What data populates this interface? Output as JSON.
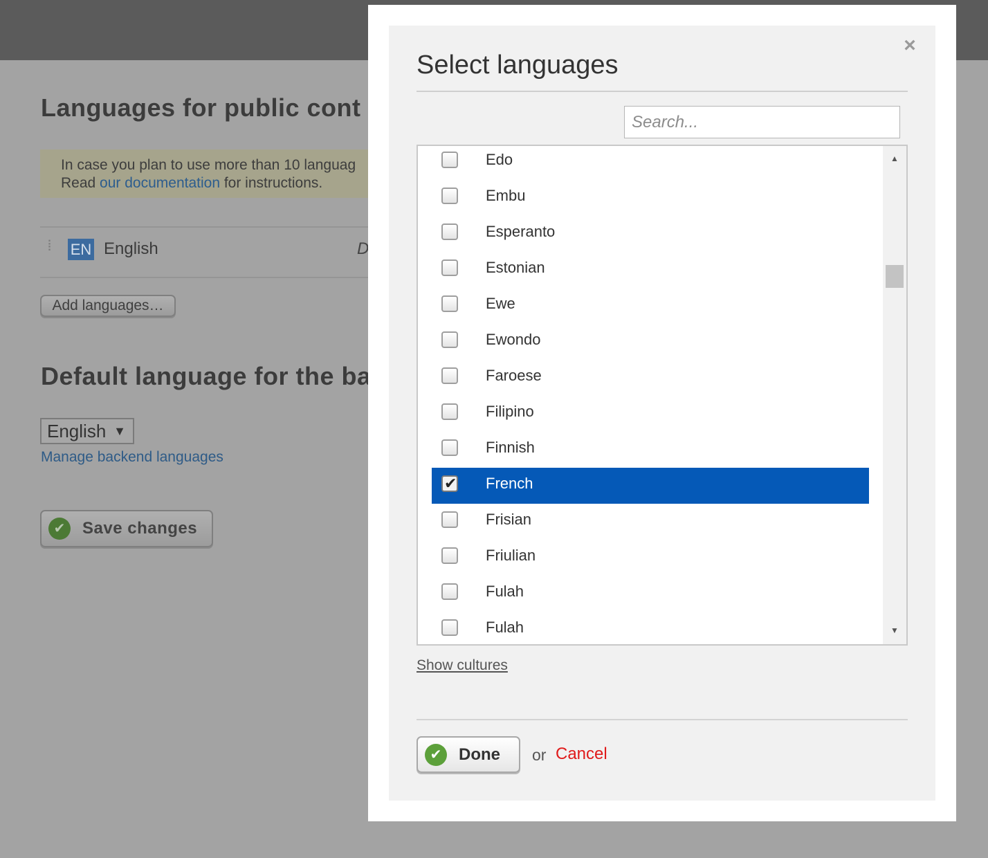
{
  "background": {
    "heading_public": "Languages for public cont",
    "notice_line1": "In case you plan to use more than 10 languag",
    "notice_line2_prefix": "Read ",
    "notice_link": "our documentation",
    "notice_line2_suffix": " for instructions.",
    "language_row": {
      "code": "EN",
      "name": "English",
      "trailing": "D"
    },
    "add_languages_label": "Add languages…",
    "heading_default": "Default language for the ba",
    "backend_select_value": "English",
    "manage_link": "Manage backend languages",
    "save_label": "Save changes"
  },
  "modal": {
    "title": "Select languages",
    "close_glyph": "×",
    "search_placeholder": "Search...",
    "languages": [
      {
        "name": "Edo",
        "checked": false
      },
      {
        "name": "Embu",
        "checked": false
      },
      {
        "name": "Esperanto",
        "checked": false
      },
      {
        "name": "Estonian",
        "checked": false
      },
      {
        "name": "Ewe",
        "checked": false
      },
      {
        "name": "Ewondo",
        "checked": false
      },
      {
        "name": "Faroese",
        "checked": false
      },
      {
        "name": "Filipino",
        "checked": false
      },
      {
        "name": "Finnish",
        "checked": false
      },
      {
        "name": "French",
        "checked": true
      },
      {
        "name": "Frisian",
        "checked": false
      },
      {
        "name": "Friulian",
        "checked": false
      },
      {
        "name": "Fulah",
        "checked": false
      },
      {
        "name": "Fulah",
        "checked": false
      }
    ],
    "selected_language": "French",
    "show_cultures_label": "Show cultures",
    "done_label": "Done",
    "or_text": "or",
    "cancel_label": "Cancel"
  },
  "icons": {
    "checkmark": "✔",
    "scroll_up": "▲",
    "scroll_down": "▼",
    "select_arrow": "▼",
    "drag_handle": "⡇"
  },
  "colors": {
    "selection_blue": "#0559b7",
    "done_green": "#5ca03a",
    "cancel_red": "#e01a1a",
    "overlay_gray": "#a3a3a3"
  }
}
